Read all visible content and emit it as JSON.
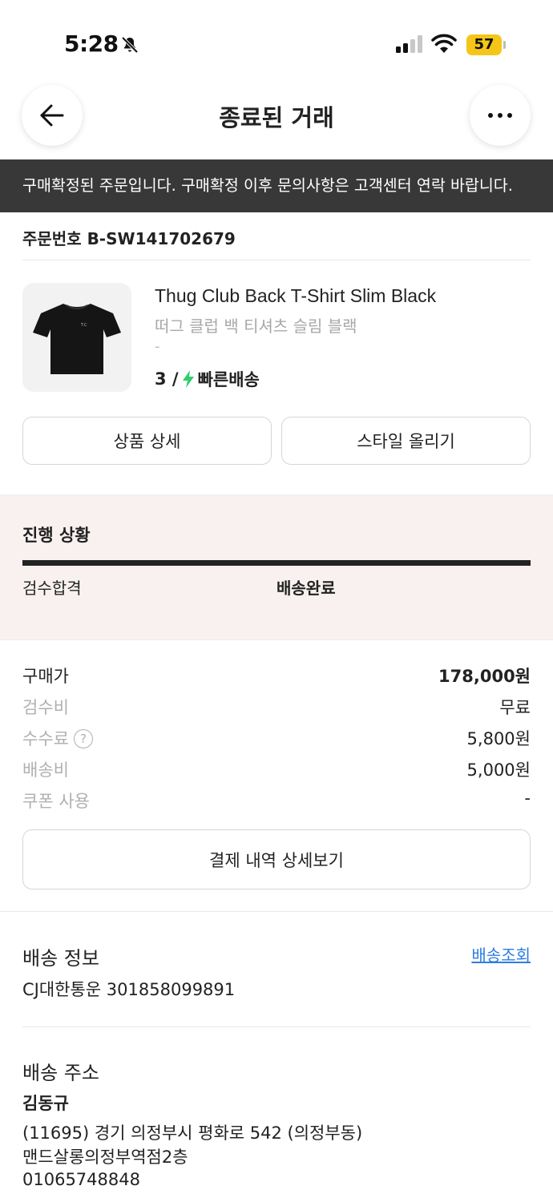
{
  "status_bar": {
    "time": "5:28",
    "battery": "57"
  },
  "header": {
    "title": "종료된 거래"
  },
  "banner": {
    "text": "구매확정된 주문입니다. 구매확정 이후 문의사항은 고객센터 연락 바랍니다."
  },
  "order": {
    "number_label": "주문번호 B-SW141702679"
  },
  "product": {
    "name": "Thug Club Back T-Shirt Slim Black",
    "korean_name": "떠그 클럽 백 티셔츠 슬림 블랙",
    "option": "-",
    "size": "3 /",
    "delivery_badge": "빠른배송",
    "delivery_color": "#2bd06b"
  },
  "buttons": {
    "product_detail": "상품 상세",
    "upload_style": "스타일 올리기",
    "payment_detail": "결제 내역 상세보기"
  },
  "progress": {
    "title": "진행 상황",
    "steps": [
      "검수합격",
      "배송완료"
    ],
    "completed_fraction": 1.0
  },
  "price": {
    "purchase_label": "구매가",
    "purchase_value": "178,000원",
    "inspection_label": "검수비",
    "inspection_value": "무료",
    "fee_label": "수수료",
    "fee_help": "?",
    "fee_value": "5,800원",
    "shipping_label": "배송비",
    "shipping_value": "5,000원",
    "coupon_label": "쿠폰 사용",
    "coupon_value": "-"
  },
  "shipping_info": {
    "title": "배송 정보",
    "track_link": "배송조회",
    "carrier": "CJ대한통운 301858099891"
  },
  "address": {
    "title": "배송 주소",
    "name": "김동규",
    "line1": "(11695) 경기 의정부시 평화로 542 (의정부동)",
    "line2": "맨드살롱의정부역점2층",
    "phone": "01065748848"
  },
  "colors": {
    "banner_bg": "#383838",
    "progress_bg": "#f9f1f0",
    "link": "#2c7de0",
    "battery": "#f5c518"
  }
}
